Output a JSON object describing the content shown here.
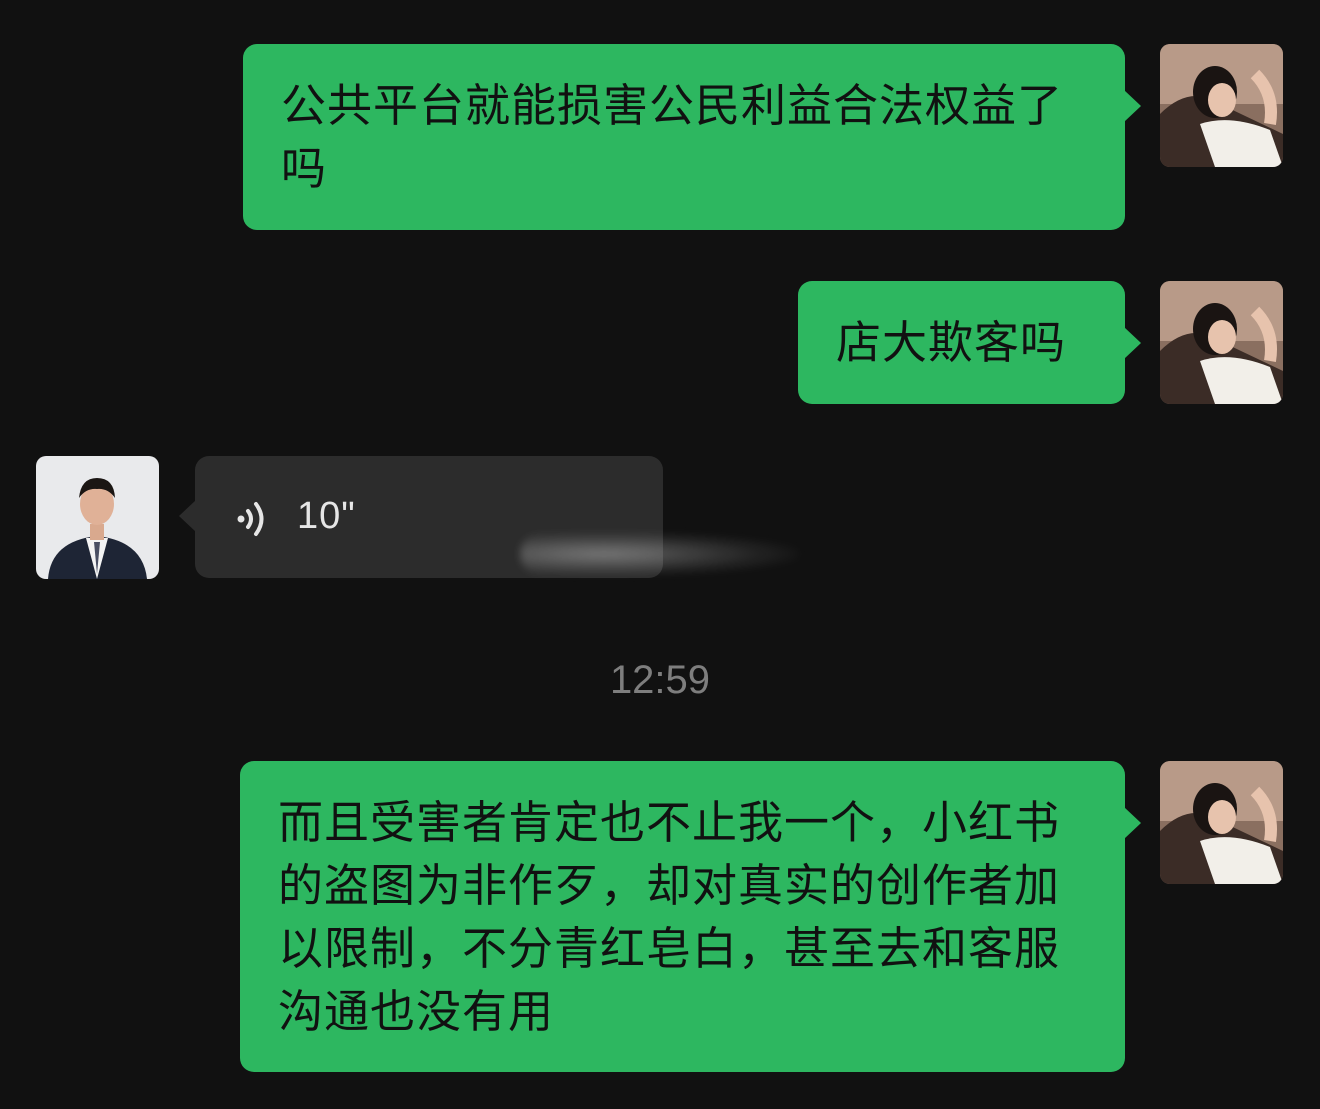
{
  "messages": [
    {
      "side": "out",
      "text": "公共平台就能损害公民利益合法权益了吗"
    },
    {
      "side": "out",
      "text": "店大欺客吗"
    },
    {
      "side": "in",
      "type": "voice",
      "duration": "10\""
    },
    {
      "side": "out",
      "text": "而且受害者肯定也不止我一个，小红书的盗图为非作歹，却对真实的创作者加以限制，不分青红皂白，甚至去和客服沟通也没有用"
    }
  ],
  "timestamp": "12:59",
  "colors": {
    "background": "#111111",
    "outgoing_bubble": "#2db760",
    "incoming_bubble": "#2c2c2c",
    "timestamp_text": "#7e7e7e"
  },
  "icons": {
    "voice": "voice-wave-icon",
    "self_avatar": "user-avatar",
    "contact_avatar": "contact-avatar"
  }
}
